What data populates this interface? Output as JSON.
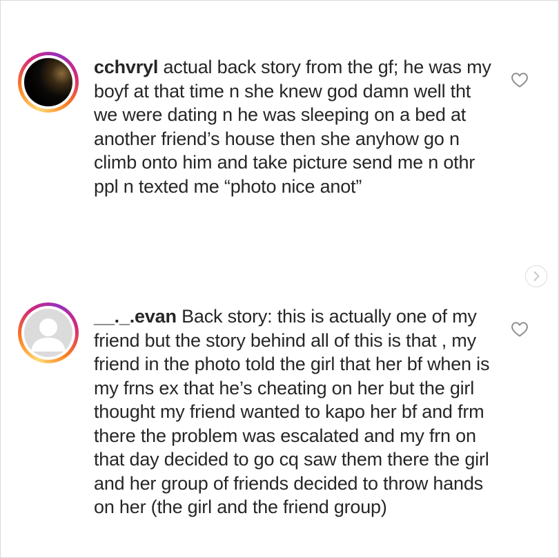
{
  "comments": [
    {
      "username": "cchvryl",
      "text": "actual back story from the gf; he was my boyf at that time n she knew god damn well tht we were dating n he was sleeping on a bed at another friend’s house then she anyhow go n climb onto him and take picture send me n othr ppl n texted me “photo nice anot”",
      "avatar": "profile-photo-dark",
      "like_icon": "heart-outline-icon"
    },
    {
      "username": "__._.evan",
      "text": "Back story: this is actually one of my friend but the story behind all of this is that , my friend in the photo told the girl that her bf when is my frns ex that he’s cheating on her but the girl thought my friend wanted to kapo her bf and frm there the problem was escalated and my frn on that day decided to go cq saw them there the girl and her group of friends decided to throw hands on her (the girl and the friend group)",
      "avatar": "default-user-avatar",
      "like_icon": "heart-outline-icon"
    }
  ],
  "navigation": {
    "next_icon": "chevron-right-icon"
  },
  "colors": {
    "text": "#262626",
    "icon_gray": "#8e8e8e",
    "ring_gradient": [
      "#feda75",
      "#fa7e1e",
      "#d62976",
      "#962fbf"
    ]
  }
}
